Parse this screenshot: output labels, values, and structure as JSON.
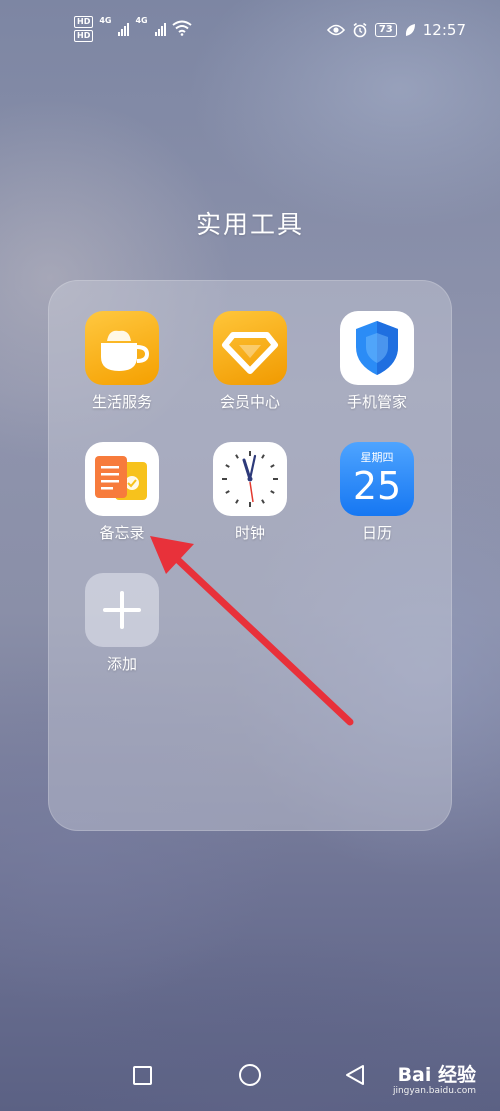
{
  "status_bar": {
    "hd_badge": "HD",
    "network_1": "4G",
    "network_2": "4G",
    "battery": "73",
    "time": "12:57"
  },
  "folder": {
    "title": "实用工具",
    "apps": [
      {
        "label": "生活服务",
        "icon": "coffee-cup-icon"
      },
      {
        "label": "会员中心",
        "icon": "gem-icon"
      },
      {
        "label": "手机管家",
        "icon": "shield-icon"
      },
      {
        "label": "备忘录",
        "icon": "memo-icon"
      },
      {
        "label": "时钟",
        "icon": "clock-icon"
      },
      {
        "label": "日历",
        "icon": "calendar-icon",
        "weekday": "星期四",
        "day": "25"
      },
      {
        "label": "添加",
        "icon": "plus-icon"
      }
    ]
  },
  "watermark": {
    "main": "Bai 经验",
    "sub": "jingyan.baidu.com"
  },
  "colors": {
    "annotation_arrow": "#e8313a",
    "app_orange": "#f5a000",
    "calendar_blue": "#1677f2"
  }
}
